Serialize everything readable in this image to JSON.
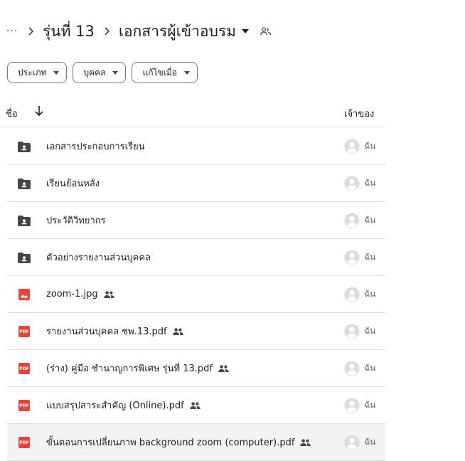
{
  "breadcrumb": {
    "more": "···",
    "parent": "รุ่นที่ 13",
    "current": "เอกสารผู้เข้าอบรม"
  },
  "filters": [
    {
      "label": "ประเภท"
    },
    {
      "label": "บุคคล"
    },
    {
      "label": "แก้ไขเมื่อ"
    }
  ],
  "table": {
    "name_header": "ชื่อ",
    "owner_header": "เจ้าของ"
  },
  "files": [
    {
      "name": "เอกสารประกอบการเรียน",
      "type": "shared-folder",
      "shared": false,
      "owner": "ฉัน"
    },
    {
      "name": "เรียนย้อนหลัง",
      "type": "shared-folder",
      "shared": false,
      "owner": "ฉัน"
    },
    {
      "name": "ประวัติวิทยากร",
      "type": "shared-folder",
      "shared": false,
      "owner": "ฉัน"
    },
    {
      "name": "ตัวอย่างรายงานส่วนบุคคล",
      "type": "shared-folder",
      "shared": false,
      "owner": "ฉัน"
    },
    {
      "name": "zoom-1.jpg",
      "type": "image",
      "shared": true,
      "owner": "ฉัน"
    },
    {
      "name": "รายงานส่วนบุคคล ชพ.13.pdf",
      "type": "pdf",
      "shared": true,
      "owner": "ฉัน"
    },
    {
      "name": "(ร่าง) คู่มือ ชำนาญการพิเศษ รุ่นที่ 13.pdf",
      "type": "pdf",
      "shared": true,
      "owner": "ฉัน"
    },
    {
      "name": "แบบสรุปสาระสำคัญ (Online).pdf",
      "type": "pdf",
      "shared": true,
      "owner": "ฉัน"
    },
    {
      "name": "ขั้นตอนการเปลี่ยนภาพ background zoom (computer).pdf",
      "type": "pdf",
      "shared": true,
      "owner": "ฉัน",
      "selected": true
    }
  ],
  "icons": {
    "pdf_badge": "PDF",
    "folder_color": "#444746",
    "pdf_color": "#ea4335",
    "image_color": "#ea4335"
  }
}
